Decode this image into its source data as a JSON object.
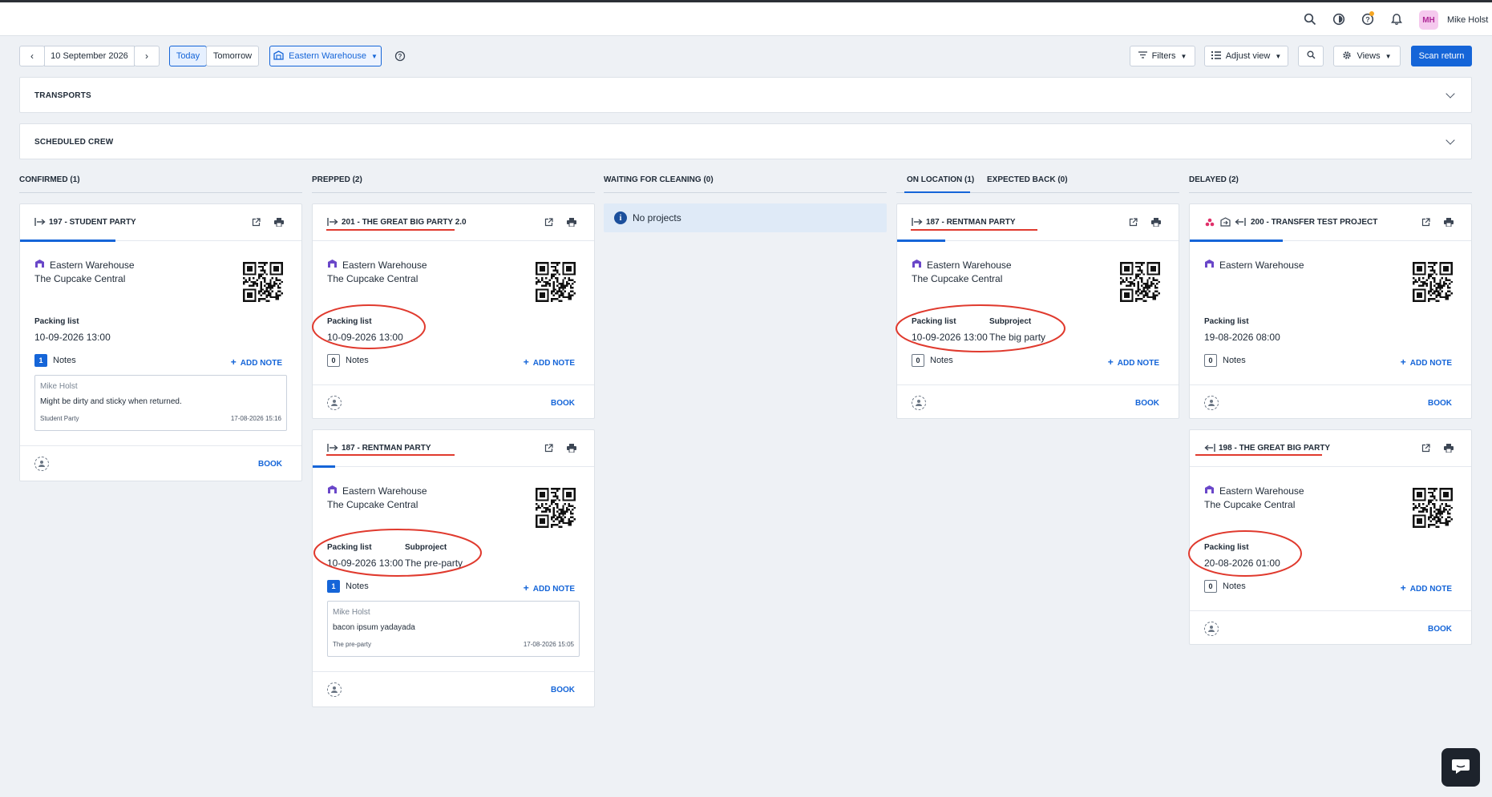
{
  "user": {
    "initials": "MH",
    "name": "Mike Holst"
  },
  "toolbar": {
    "date": "10 September 2026",
    "today_label": "Today",
    "tomorrow_label": "Tomorrow",
    "warehouse_label": "Eastern Warehouse",
    "filters_label": "Filters",
    "adjust_view_label": "Adjust view",
    "views_label": "Views",
    "scan_return_label": "Scan return"
  },
  "panels": {
    "transports": "TRANSPORTS",
    "scheduled_crew": "SCHEDULED CREW"
  },
  "columns": {
    "confirmed": "CONFIRMED (1)",
    "prepped": "PREPPED (2)",
    "waiting": "WAITING FOR CLEANING (0)",
    "on_location": "ON LOCATION (1)",
    "expected_back": "EXPECTED BACK (0)",
    "delayed": "DELAYED (2)"
  },
  "empty_state": "No projects",
  "common": {
    "packing_list": "Packing list",
    "subproject": "Subproject",
    "notes": "Notes",
    "add_note": "ADD NOTE",
    "book": "BOOK"
  },
  "cards": {
    "c197": {
      "title": "197 - STUDENT PARTY",
      "warehouse": "Eastern Warehouse",
      "venue": "The Cupcake Central",
      "packing_date": "10-09-2026 13:00",
      "notes_count": "1",
      "progress": 0.34,
      "note": {
        "author": "Mike Holst",
        "text": "Might be dirty and sticky when returned.",
        "project": "Student Party",
        "date": "17-08-2026 15:16"
      }
    },
    "c201": {
      "title": "201 - THE GREAT BIG PARTY 2.0",
      "warehouse": "Eastern Warehouse",
      "venue": "The Cupcake Central",
      "packing_date": "10-09-2026 13:00",
      "notes_count": "0",
      "progress": 0
    },
    "c187a": {
      "title": "187 - RENTMAN PARTY",
      "warehouse": "Eastern Warehouse",
      "venue": "The Cupcake Central",
      "packing_date": "10-09-2026 13:00",
      "subproject": "The pre-party",
      "notes_count": "1",
      "progress": 0.08,
      "note": {
        "author": "Mike Holst",
        "text": "bacon ipsum yadayada",
        "project": "The pre-party",
        "date": "17-08-2026 15:05"
      }
    },
    "c187b": {
      "title": "187 - RENTMAN PARTY",
      "warehouse": "Eastern Warehouse",
      "venue": "The Cupcake Central",
      "packing_date": "10-09-2026 13:00",
      "subproject": "The big party",
      "notes_count": "0",
      "progress": 0.17
    },
    "c200": {
      "title": "200 - TRANSFER TEST PROJECT",
      "warehouse": "Eastern Warehouse",
      "packing_date": "19-08-2026 08:00",
      "notes_count": "0",
      "progress": 0.33
    },
    "c198": {
      "title": "198 - THE GREAT BIG PARTY",
      "warehouse": "Eastern Warehouse",
      "venue": "The Cupcake Central",
      "packing_date": "20-08-2026 01:00",
      "notes_count": "0",
      "progress": 0
    }
  },
  "colors": {
    "accent": "#1565d8",
    "annotation": "#e03a2e"
  }
}
